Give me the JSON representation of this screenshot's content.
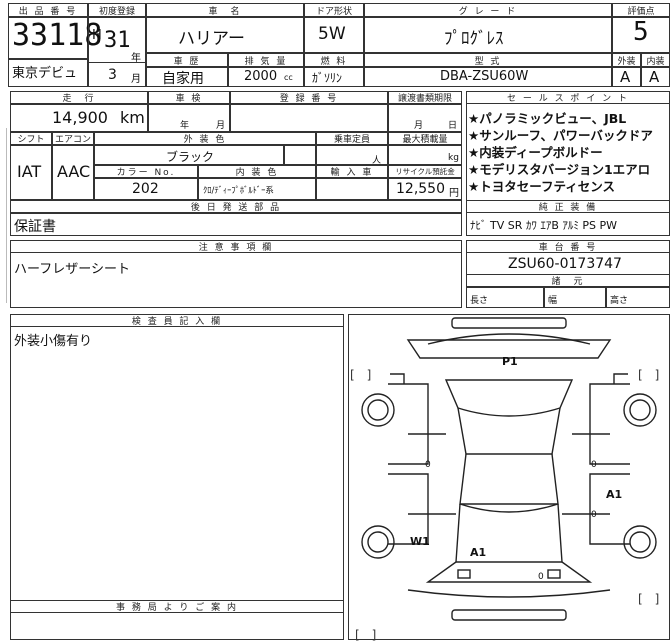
{
  "header": {
    "lot_label": "出 品 番 号",
    "lot_number": "33118",
    "venue": "東京デビュ",
    "first_reg_label": "初度登録",
    "era": "H",
    "year": "31",
    "year_unit": "年",
    "month": "3",
    "month_unit": "月",
    "model_label": "車　名",
    "model": "ハリアー",
    "history_label": "車 歴",
    "history": "自家用",
    "displacement_label": "排 気 量",
    "displacement": "2000",
    "displacement_unit": "cc",
    "door_label": "ドア形状",
    "door": "5W",
    "fuel_label": "燃 料",
    "fuel": "ｶﾞｿﾘﾝ",
    "grade_label": "グ レ ー ド",
    "grade": "ﾌﾟﾛｸﾞﾚｽ",
    "type_label": "型 式",
    "type": "DBA-ZSU60W",
    "score_label": "評価点",
    "score": "5",
    "ext_label": "外装",
    "ext": "A",
    "int_label": "内装",
    "int": "A"
  },
  "details": {
    "mileage_label": "走　行",
    "mileage": "14,900",
    "mileage_unit": "km",
    "inspection_label": "車 検",
    "insp_year_unit": "年",
    "insp_month_unit": "月",
    "reg_no_label": "登 録 番 号",
    "transfer_label": "譲渡書類期限",
    "transfer_month": "月",
    "transfer_day": "日",
    "shift_label": "シフト",
    "shift": "IAT",
    "ac_label": "エアコン",
    "ac": "AAC",
    "color_label": "外 装 色",
    "color": "ブラック",
    "capacity_label": "乗車定員",
    "capacity_unit": "人",
    "load_label": "最大積載量",
    "load_unit": "kg",
    "color_no_label": "カラー No.",
    "color_no": "202",
    "interior_label": "内 装 色",
    "interior": "ｸﾛ/ﾃﾞｨｰﾌﾟﾎﾞﾙﾄﾞｰ系",
    "import_label": "輸 入 車",
    "recycle_label": "リサイクル預託金",
    "recycle": "12,550",
    "recycle_unit": "円",
    "later_parts_label": "後 日 発 送 部 品",
    "later_parts": "保証書"
  },
  "sales_points": {
    "label": "セ ー ル ス ポ イ ン ト",
    "items": [
      "★パノラミックビュー、JBL",
      "★サンルーフ、パワーバックドア",
      "★内装ディープボルドー",
      "★モデリスタバージョン1エアロ",
      "★トヨタセーフティセンス"
    ],
    "equipment_label": "純 正 装 備",
    "equipment": "ﾅﾋﾞ TV SR ｶﾜ ｴｱB ｱﾙﾐ PS PW"
  },
  "notes": {
    "label": "注 意 事 項 欄",
    "text": "ハーフレザーシート"
  },
  "chassis": {
    "label": "車 台 番 号",
    "number": "ZSU60-0173747",
    "dims_label": "諸　元",
    "length_label": "長さ",
    "width_label": "幅",
    "height_label": "高さ"
  },
  "inspector": {
    "label": "検 査 員 記 入 欄",
    "text": "外装小傷有り",
    "office_label": "事 務 局 よ り ご 案 内"
  },
  "diagram": {
    "marks": [
      "P1",
      "A1",
      "A1",
      "W1"
    ],
    "zeros": [
      "0",
      "0",
      "0",
      "0"
    ],
    "bracket": "[　]"
  }
}
